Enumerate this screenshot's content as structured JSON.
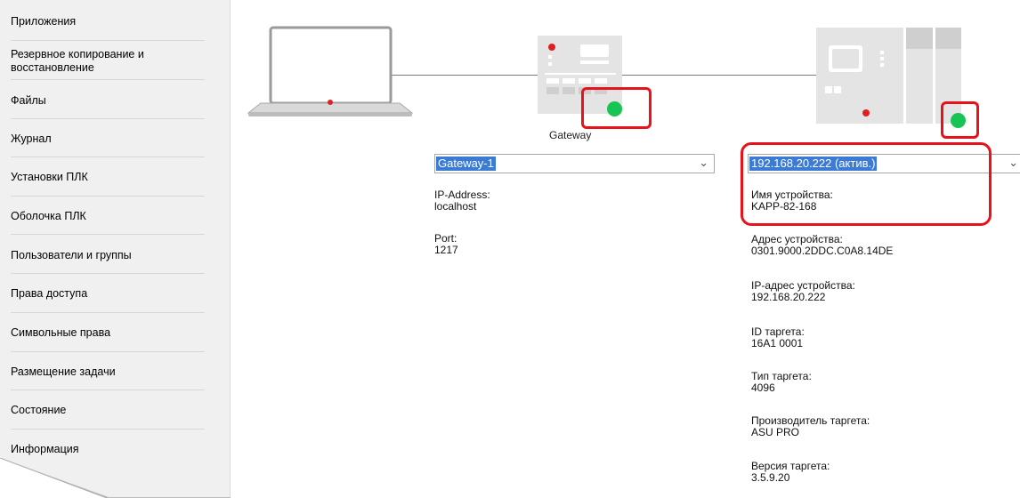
{
  "sidebar": {
    "items": [
      {
        "label": "Приложения"
      },
      {
        "label": "Резервное копирование и восстановление"
      },
      {
        "label": "Файлы"
      },
      {
        "label": "Журнал"
      },
      {
        "label": "Установки ПЛК"
      },
      {
        "label": "Оболочка ПЛК"
      },
      {
        "label": "Пользователи и группы"
      },
      {
        "label": "Права доступа"
      },
      {
        "label": "Символьные права"
      },
      {
        "label": "Размещение задачи"
      },
      {
        "label": "Состояние"
      },
      {
        "label": "Информация"
      }
    ]
  },
  "topology": {
    "gateway_caption": "Gateway",
    "status_color": "#18c454",
    "highlight_color": "#e8121a",
    "icons": [
      "laptop-icon",
      "gateway-device-icon",
      "plc-device-icon"
    ]
  },
  "gateway": {
    "selected": "Gateway-1",
    "ip_label": "IP-Address:",
    "ip_value": "localhost",
    "port_label": "Port:",
    "port_value": "1217"
  },
  "device": {
    "selected": "192.168.20.222 (актив.)",
    "name_label": "Имя устройства:",
    "name_value": "KAPP-82-168",
    "address_label": "Адрес устройства:",
    "address_value": "0301.9000.2DDC.C0A8.14DE",
    "ip_label": "IP-адрес устройства:",
    "ip_value": "192.168.20.222",
    "target_id_label": "ID таргета:",
    "target_id_value": "16A1 0001",
    "target_type_label": "Тип таргета:",
    "target_type_value": "4096",
    "vendor_label": "Производитель таргета:",
    "vendor_value": "ASU PRO",
    "version_label": "Версия таргета:",
    "version_value": "3.5.9.20"
  }
}
